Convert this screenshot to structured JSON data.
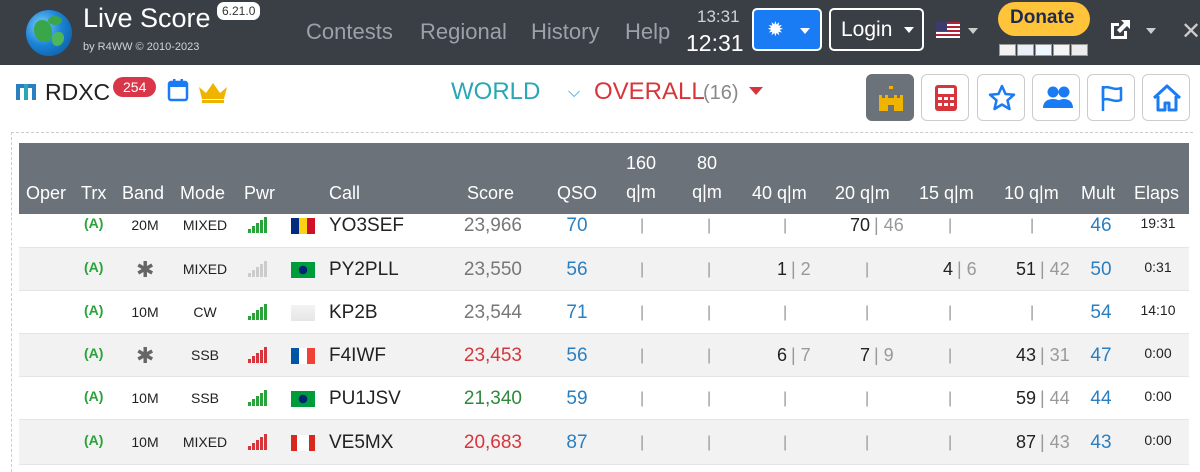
{
  "header": {
    "app_title": "Live Score",
    "version": "6.21.0",
    "copyright": "by R4WW © 2010-2023",
    "nav": [
      "Contests",
      "Regional",
      "History",
      "Help"
    ],
    "clock_local": "13:31",
    "clock_utc": "12:31",
    "login_label": "Login",
    "donate_label": "Donate"
  },
  "contest": {
    "name": "RDXC",
    "count": "254",
    "scope": "WORLD",
    "category": "OVERALL",
    "category_count": "(16)"
  },
  "table": {
    "headers": {
      "oper": "Oper",
      "trx": "Trx",
      "band": "Band",
      "mode": "Mode",
      "pwr": "Pwr",
      "call": "Call",
      "score": "Score",
      "qso": "QSO",
      "b160_top": "160",
      "b160_bot": "q|m",
      "b80_top": "80",
      "b80_bot": "q|m",
      "b40": "40 q|m",
      "b20": "20 q|m",
      "b15": "15 q|m",
      "b10": "10 q|m",
      "mult": "Mult",
      "elaps": "Elaps"
    },
    "rows": [
      {
        "trx": "(A)",
        "band": "20M",
        "mode": "MIXED",
        "call": "YO3SEF",
        "score": "23,966",
        "qso": "70",
        "b40": "",
        "b20": "70",
        "b20m": "46",
        "b15": "",
        "b15m": "",
        "b10": "",
        "b10m": "",
        "b40m": "",
        "mult": "46",
        "elaps": "19:31"
      },
      {
        "trx": "(A)",
        "band": "*",
        "mode": "MIXED",
        "call": "PY2PLL",
        "score": "23,550",
        "qso": "56",
        "b40": "1",
        "b40m": "2",
        "b20": "",
        "b20m": "",
        "b15": "4",
        "b15m": "6",
        "b10": "51",
        "b10m": "42",
        "mult": "50",
        "elaps": "0:31"
      },
      {
        "trx": "(A)",
        "band": "10M",
        "mode": "CW",
        "call": "KP2B",
        "score": "23,544",
        "qso": "71",
        "b40": "",
        "b40m": "",
        "b20": "",
        "b20m": "",
        "b15": "",
        "b15m": "",
        "b10": "",
        "b10m": "",
        "mult": "54",
        "elaps": "14:10"
      },
      {
        "trx": "(A)",
        "band": "*",
        "mode": "SSB",
        "call": "F4IWF",
        "score": "23,453",
        "qso": "56",
        "b40": "6",
        "b40m": "7",
        "b20": "7",
        "b20m": "9",
        "b15": "",
        "b15m": "",
        "b10": "43",
        "b10m": "31",
        "mult": "47",
        "elaps": "0:00"
      },
      {
        "trx": "(A)",
        "band": "10M",
        "mode": "SSB",
        "call": "PU1JSV",
        "score": "21,340",
        "qso": "59",
        "b40": "",
        "b40m": "",
        "b20": "",
        "b20m": "",
        "b15": "",
        "b15m": "",
        "b10": "59",
        "b10m": "44",
        "mult": "44",
        "elaps": "0:00"
      },
      {
        "trx": "(A)",
        "band": "10M",
        "mode": "MIXED",
        "call": "VE5MX",
        "score": "20,683",
        "qso": "87",
        "b40": "",
        "b40m": "",
        "b20": "",
        "b20m": "",
        "b15": "",
        "b15m": "",
        "b10": "87",
        "b10m": "43",
        "mult": "43",
        "elaps": "0:00"
      }
    ]
  },
  "colors": {
    "navbar": "#3a3f45",
    "table_header": "#6c7279",
    "score_red": "#d6363b",
    "score_green": "#2e8a3a",
    "link_blue": "#2a7fc1",
    "trx_green": "#2aa33a"
  }
}
